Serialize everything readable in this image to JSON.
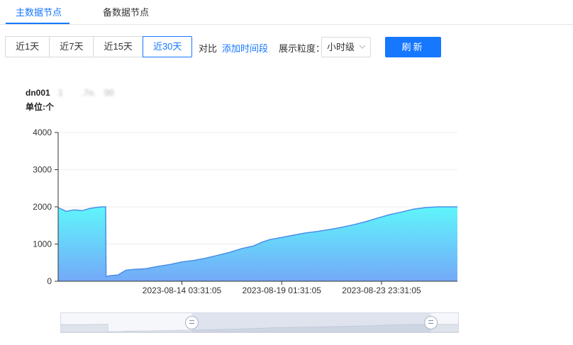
{
  "tabs": [
    {
      "label": "主数据节点",
      "active": true
    },
    {
      "label": "备数据节点",
      "active": false
    }
  ],
  "range_buttons": [
    {
      "label": "近1天",
      "active": false
    },
    {
      "label": "近7天",
      "active": false
    },
    {
      "label": "近15天",
      "active": false
    },
    {
      "label": "近30天",
      "active": true
    }
  ],
  "compare_label": "对比",
  "add_period_label": "添加时间段",
  "granularity": {
    "label": "展示粒度：",
    "value": "小时级"
  },
  "refresh_label": "刷新",
  "chart_header": {
    "node_name": "dn001",
    "node_ip": "1           .7o.     00",
    "unit": "单位:个"
  },
  "colors": {
    "accent": "#1677ff",
    "area_top": "#5ff5fb",
    "area_bottom": "#74a9f9",
    "line": "#4a8ee8"
  },
  "chart_data": {
    "type": "area",
    "y_ticks": [
      0,
      1000,
      2000,
      3000,
      4000
    ],
    "ylim": [
      0,
      4000
    ],
    "x_tick_labels": [
      "2023-08-14 03:31:05",
      "2023-08-19 01:31:05",
      "2023-08-23 23:31:05"
    ],
    "x_tick_positions": [
      0.31,
      0.56,
      0.81
    ],
    "grid": true,
    "series": [
      {
        "values": [
          [
            0.0,
            1980
          ],
          [
            0.02,
            1880
          ],
          [
            0.04,
            1920
          ],
          [
            0.06,
            1900
          ],
          [
            0.08,
            1960
          ],
          [
            0.1,
            1990
          ],
          [
            0.11,
            2000
          ],
          [
            0.119,
            2000
          ],
          [
            0.12,
            130
          ],
          [
            0.13,
            150
          ],
          [
            0.15,
            170
          ],
          [
            0.17,
            300
          ],
          [
            0.19,
            320
          ],
          [
            0.22,
            340
          ],
          [
            0.25,
            400
          ],
          [
            0.28,
            450
          ],
          [
            0.31,
            520
          ],
          [
            0.34,
            560
          ],
          [
            0.37,
            620
          ],
          [
            0.4,
            700
          ],
          [
            0.43,
            780
          ],
          [
            0.46,
            880
          ],
          [
            0.49,
            950
          ],
          [
            0.51,
            1050
          ],
          [
            0.53,
            1120
          ],
          [
            0.56,
            1180
          ],
          [
            0.59,
            1240
          ],
          [
            0.62,
            1300
          ],
          [
            0.65,
            1340
          ],
          [
            0.68,
            1390
          ],
          [
            0.71,
            1450
          ],
          [
            0.74,
            1520
          ],
          [
            0.77,
            1600
          ],
          [
            0.8,
            1700
          ],
          [
            0.83,
            1790
          ],
          [
            0.86,
            1860
          ],
          [
            0.89,
            1940
          ],
          [
            0.92,
            1980
          ],
          [
            0.95,
            2000
          ],
          [
            1.0,
            2000
          ]
        ]
      }
    ],
    "zoom_range": [
      0.33,
      0.93
    ]
  }
}
